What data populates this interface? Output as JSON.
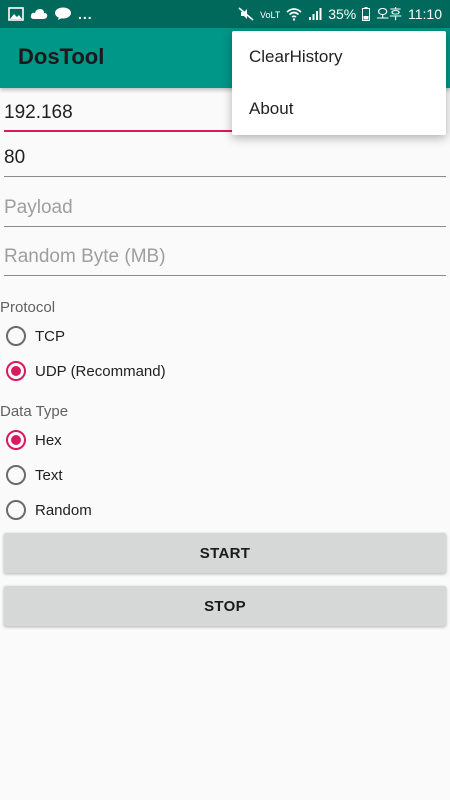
{
  "status_bar": {
    "left_icons": [
      "image-icon",
      "cloud-icon",
      "talk-icon"
    ],
    "overflow": "...",
    "battery": "35%",
    "ampm": "오후",
    "time": "11:10"
  },
  "toolbar": {
    "title": "DosTool"
  },
  "menu": {
    "items": [
      {
        "label": "ClearHistory"
      },
      {
        "label": "About"
      }
    ]
  },
  "form": {
    "ip": {
      "value": "192.168",
      "placeholder": ""
    },
    "port": {
      "value": "80",
      "placeholder": ""
    },
    "payload": {
      "value": "",
      "placeholder": "Payload"
    },
    "random_byte": {
      "value": "",
      "placeholder": "Random Byte (MB)"
    }
  },
  "protocol": {
    "label": "Protocol",
    "options": [
      {
        "label": "TCP",
        "checked": false
      },
      {
        "label": "UDP (Recommand)",
        "checked": true
      }
    ]
  },
  "data_type": {
    "label": "Data Type",
    "options": [
      {
        "label": "Hex",
        "checked": true
      },
      {
        "label": "Text",
        "checked": false
      },
      {
        "label": "Random",
        "checked": false
      }
    ]
  },
  "buttons": {
    "start": "START",
    "stop": "STOP"
  },
  "colors": {
    "toolbar": "#009688",
    "status_bar": "#00695c",
    "accent": "#d81b60"
  }
}
